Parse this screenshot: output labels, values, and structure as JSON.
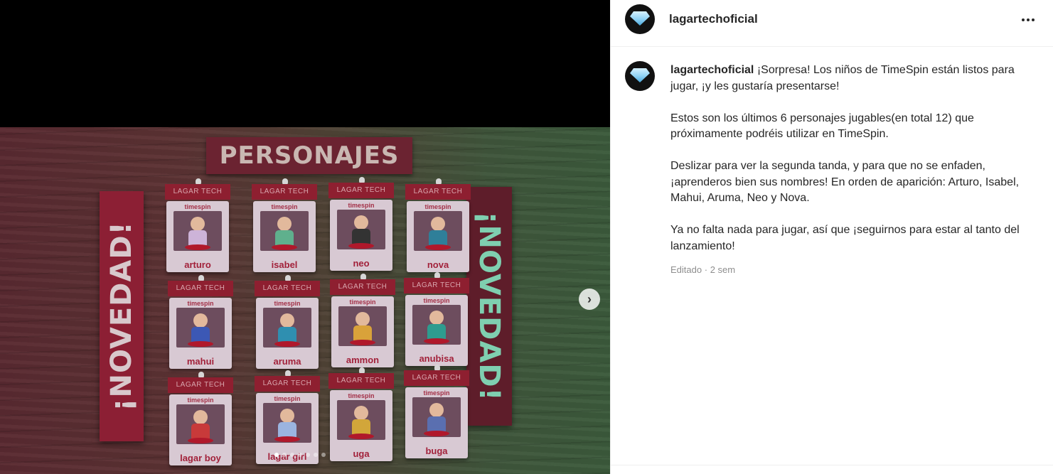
{
  "post": {
    "banner_title": "PERSONAJES",
    "side_banner_left": "¡NOVEDAD!",
    "side_banner_right": "¡NOVEDAD!",
    "tag_label": "LAGAR TECH",
    "brand_label": "timespin",
    "characters": [
      "arturo",
      "isabel",
      "neo",
      "nova",
      "mahui",
      "aruma",
      "ammon",
      "anubisa",
      "lagar boy",
      "lagar girl",
      "uga",
      "buga"
    ],
    "carousel": {
      "total_slides": 7,
      "active_index": 0
    },
    "next_icon": "chevron-right-icon"
  },
  "header": {
    "username": "lagartechoficial",
    "more_icon": "more-horizontal-icon",
    "avatar_icon": "diamond-logo"
  },
  "caption": {
    "username": "lagartechoficial",
    "p1": "¡Sorpresa! Los niños de TimeSpin están listos para jugar, ¡y les gustaría presentarse!",
    "p2": "Estos son los últimos 6 personajes jugables(en total 12) que próximamente podréis utilizar en TimeSpin.",
    "p3": "Deslizar para ver la segunda tanda, y para que no se enfaden, ¡aprenderos bien sus nombres! En orden de aparición: Arturo, Isabel, Mahui, Aruma, Neo y Nova.",
    "p4": "Ya no falta nada para jugar, así que ¡seguirnos para estar al tanto del lanzamiento!",
    "edited": "Editado",
    "separator": "·",
    "time": "2 sem"
  },
  "colors": {
    "accent_red": "#8c1f34",
    "wall_green": "#3c5b3c"
  }
}
